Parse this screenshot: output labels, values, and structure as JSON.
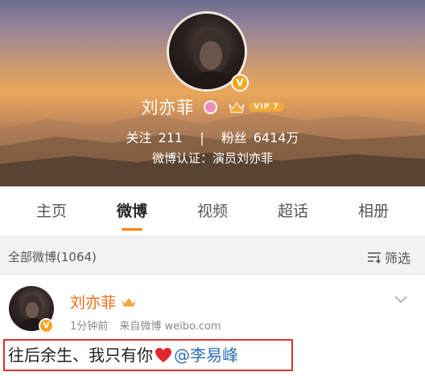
{
  "profile": {
    "name": "刘亦菲",
    "vip_label": "VIP 7",
    "verified_badge": "V",
    "stats": {
      "following_label": "关注",
      "following_count": "211",
      "separator": "|",
      "followers_label": "粉丝",
      "followers_count": "6414万"
    },
    "verification": "微博认证：演员刘亦菲"
  },
  "tabs": [
    {
      "label": "主页",
      "active": false
    },
    {
      "label": "微博",
      "active": true
    },
    {
      "label": "视频",
      "active": false
    },
    {
      "label": "超话",
      "active": false
    },
    {
      "label": "相册",
      "active": false
    }
  ],
  "filter_bar": {
    "all_label": "全部微博(1064)",
    "filter_label": "筛选"
  },
  "post": {
    "author": "刘亦菲",
    "verified_badge": "V",
    "time": "1分钟前",
    "source": "来自微博 weibo.com",
    "text_before": "往后余生、我只有你",
    "mention": "@李易峰"
  },
  "colors": {
    "accent_orange": "#ff8200",
    "author_name": "#f56c0f",
    "mention_blue": "#2f6fb6",
    "highlight_box": "#e03030",
    "heart": "#e0282e",
    "vip_gold": "#f2a93b"
  },
  "icons": [
    "pink-circle-icon",
    "crown-icon",
    "verified-v-icon",
    "filter-icon",
    "chevron-down-icon",
    "heart-icon"
  ]
}
